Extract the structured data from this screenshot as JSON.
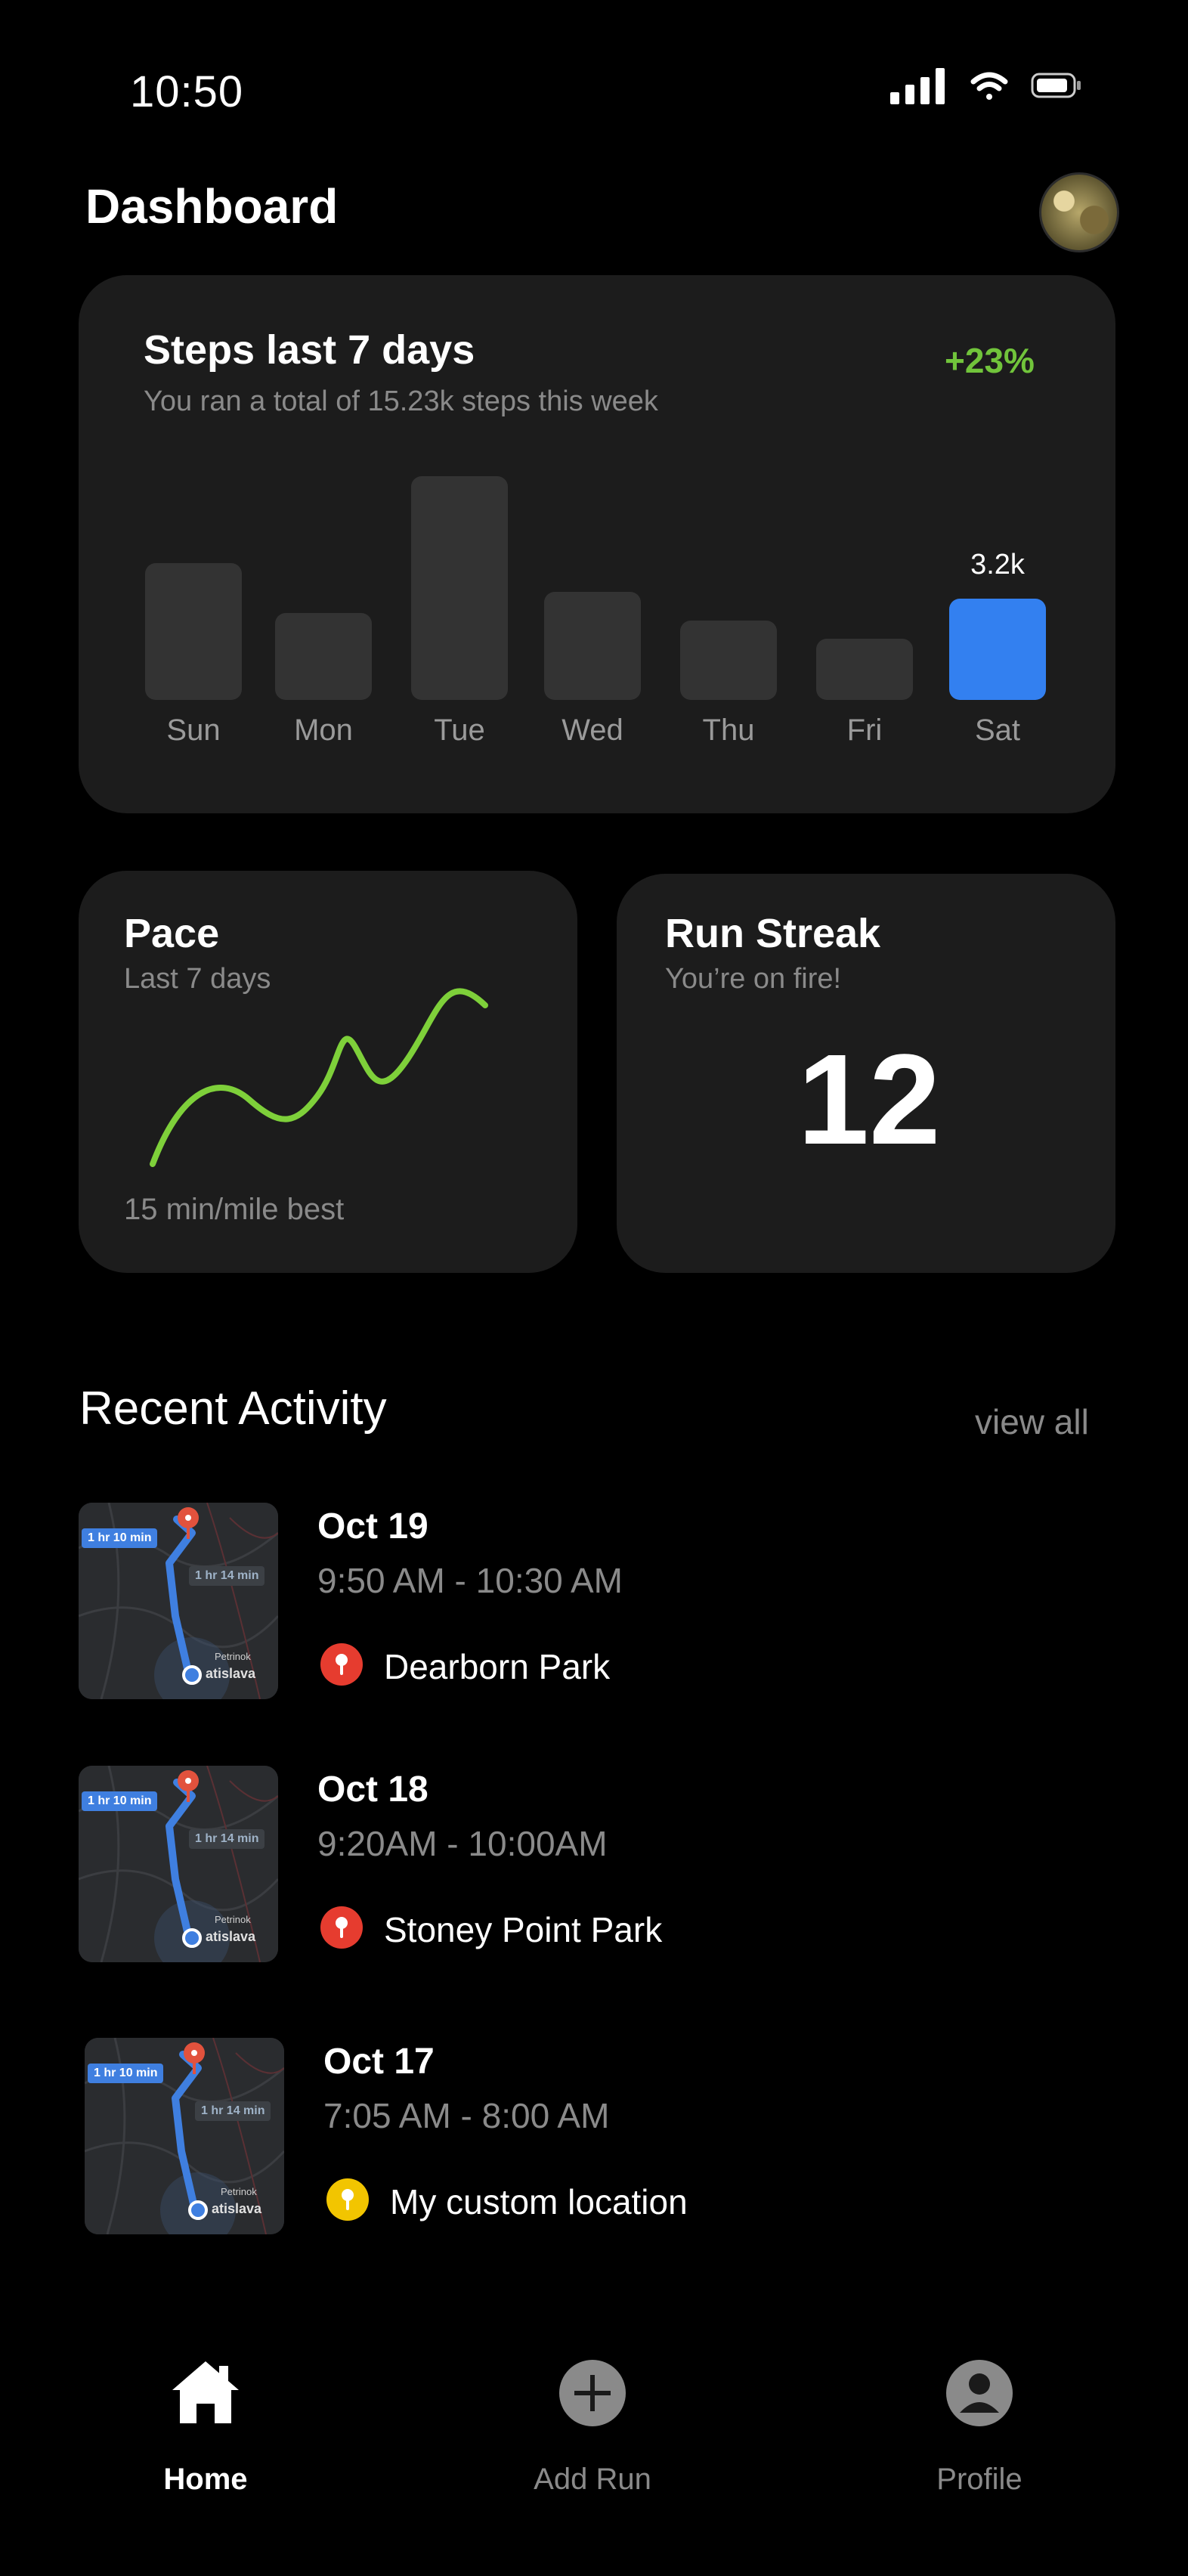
{
  "status": {
    "time": "10:50"
  },
  "header": {
    "title": "Dashboard"
  },
  "steps": {
    "title": "Steps last 7 days",
    "subtitle": "You ran a total of 15.23k steps this week",
    "change": "+23%",
    "highlight_value": "3.2k",
    "colors": {
      "bar": "#333333",
      "active": "#3380f0",
      "change": "#71c43b"
    },
    "chart_data": {
      "type": "bar",
      "categories": [
        "Sun",
        "Mon",
        "Tue",
        "Wed",
        "Thu",
        "Fri",
        "Sat"
      ],
      "values": [
        1.9,
        1.2,
        3.1,
        1.5,
        1.1,
        0.85,
        1.4
      ],
      "active_index": 6,
      "data_labels": [
        "",
        "",
        "",
        "",
        "",
        "",
        "3.2k"
      ]
    }
  },
  "pace": {
    "title": "Pace",
    "subtitle": "Last 7 days",
    "best": "15 min/mile best",
    "line_color": "#7ed03a"
  },
  "streak": {
    "title": "Run Streak",
    "subtitle": "You’re on fire!",
    "value": "12"
  },
  "recent": {
    "title": "Recent Activity",
    "view_all": "view all",
    "items": [
      {
        "date": "Oct 19",
        "time": "9:50 AM - 10:30 AM",
        "location": "Dearborn Park",
        "pin_color": "#e63c2f",
        "map_label_a": "1 hr 10 min",
        "map_label_b": "1 hr 14 min",
        "map_city": "atislava",
        "map_town": "Petrinok"
      },
      {
        "date": "Oct 18",
        "time": "9:20AM - 10:00AM",
        "location": "Stoney Point Park",
        "pin_color": "#e63c2f",
        "map_label_a": "1 hr 10 min",
        "map_label_b": "1 hr 14 min",
        "map_city": "atislava",
        "map_town": "Petrinok"
      },
      {
        "date": "Oct 17",
        "time": "7:05 AM - 8:00 AM",
        "location": "My custom location",
        "pin_color": "#f2c500",
        "map_label_a": "1 hr 10 min",
        "map_label_b": "1 hr 14 min",
        "map_city": "atislava",
        "map_town": "Petrinok"
      }
    ]
  },
  "tabbar": {
    "home": "Home",
    "add_run": "Add Run",
    "profile": "Profile"
  }
}
